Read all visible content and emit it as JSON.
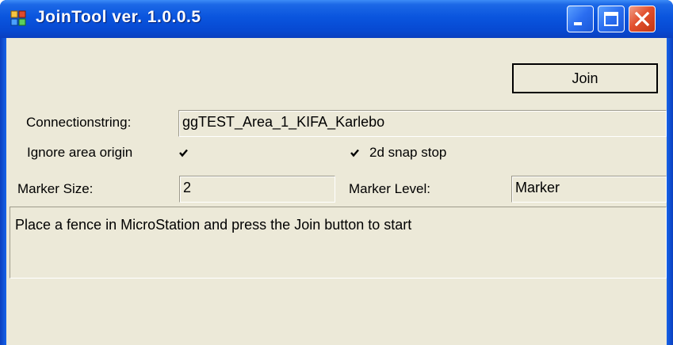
{
  "window": {
    "title": "JoinTool ver. 1.0.0.5",
    "icon": "application-icon",
    "controls": [
      "minimize-icon",
      "maximize-icon",
      "close-icon"
    ]
  },
  "form": {
    "join_label": "Join",
    "connectionstring_label": "Connectionstring:",
    "connectionstring_value": "ggTEST_Area_1_KIFA_Karlebo",
    "ignore_area_origin_label": "Ignore area origin",
    "ignore_area_origin_checked": true,
    "snap_stop_label": "2d snap stop",
    "snap_stop_checked": true,
    "marker_size_label": "Marker Size:",
    "marker_size_value": "2",
    "marker_level_label": "Marker Level:",
    "marker_level_value": "Marker",
    "status_message": "Place a fence in MicroStation and press the Join button to start"
  },
  "colors": {
    "titlebar": "#0a55de",
    "client": "#ece9d8",
    "close": "#e2502e"
  }
}
